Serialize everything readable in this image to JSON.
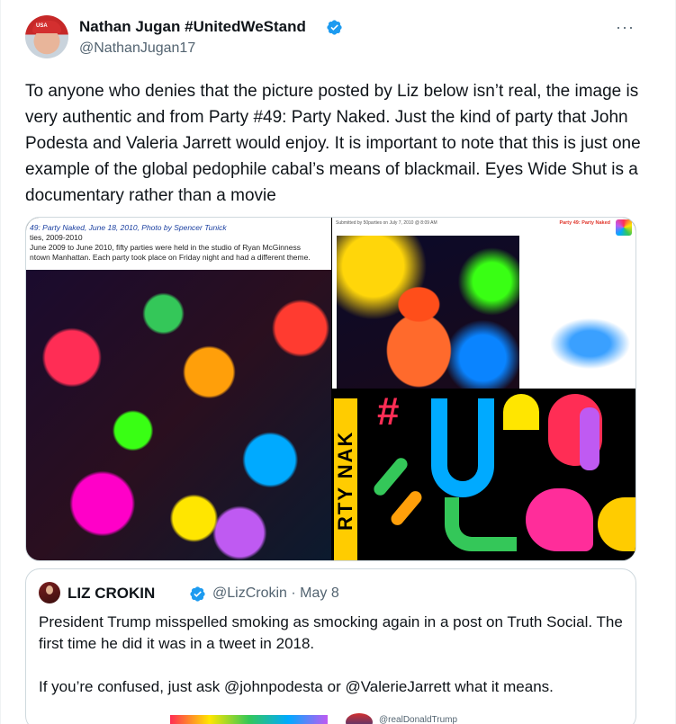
{
  "tweet": {
    "author_name": "Nathan Jugan #UnitedWeStand",
    "author_handle": "@NathanJugan17",
    "more_label": "···",
    "avatar_cap_text": "USA",
    "text": "To anyone who denies that the picture posted by Liz below isn’t real, the image is very authentic and from Party #49: Party Naked. Just the kind of party that John Podesta and Valeria Jarrett would enjoy. It is important to note that this is just one example of the global pedophile cabal’s means of blackmail. Eyes Wide Shut is a documentary rather than a movie",
    "media": {
      "left_caption_title": "49: Party Naked, June 18, 2010, Photo by Spencer Tunick",
      "left_caption_line2": "ties, 2009-2010",
      "left_caption_line3": "June 2009 to June 2010, fifty parties were held in the studio of Ryan McGinness",
      "left_caption_line4": "ntown Manhattan. Each party took place on Friday night and had a different theme.",
      "right_sub_caption": "Submitted by 50parties on July 7, 2010 @ 8:09 AM",
      "right_party_tag": "Party 49: Party Naked",
      "poster_vertical_text": "RTY NAK"
    }
  },
  "quoted_tweet": {
    "author_name": "LIZ CROKIN",
    "author_handle": "@LizCrokin",
    "separator": "·",
    "date": "May 8",
    "paragraph1": "President Trump misspelled smoking as smocking again in a post on Truth Social. The first time he did it was in a tweet in 2018.",
    "paragraph2": "If you’re confused, just ask @johnpodesta or @ValerieJarrett what it means.",
    "embedded_handle": "@realDonaldTrump"
  },
  "colors": {
    "verified_blue": "#1d9bf0",
    "text_primary": "#0f1419",
    "text_secondary": "#536471",
    "border": "#cfd9de"
  },
  "icons": {
    "verified": "verified-badge-icon",
    "more": "more-dots-icon"
  }
}
